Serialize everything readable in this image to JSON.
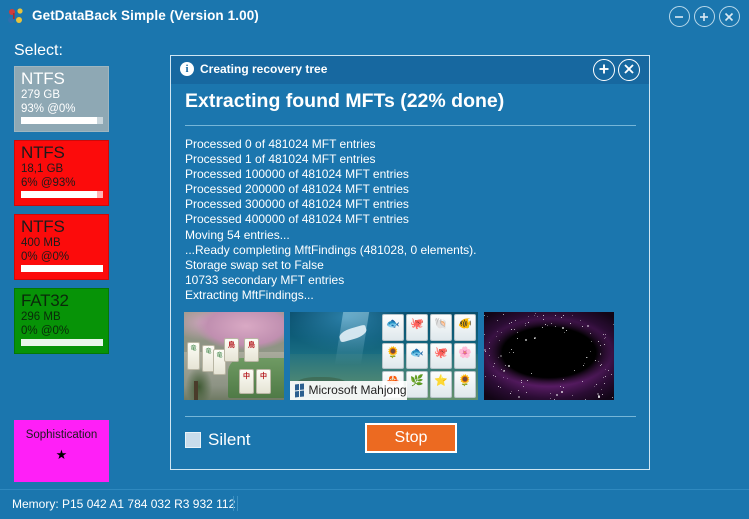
{
  "window": {
    "title": "GetDataBack Simple (Version 1.00)",
    "app_icon": "dots-icon",
    "controls": {
      "minimize": "minimize-icon",
      "maximize": "maximize-icon",
      "close": "close-icon"
    }
  },
  "sidebar": {
    "select_label": "Select:",
    "partitions": [
      {
        "filesystem": "NTFS",
        "size": "279 GB",
        "percent": "93% @0%"
      },
      {
        "filesystem": "NTFS",
        "size": "18,1 GB",
        "percent": "6% @93%"
      },
      {
        "filesystem": "NTFS",
        "size": "400 MB",
        "percent": "0% @0%"
      },
      {
        "filesystem": "FAT32",
        "size": "296 MB",
        "percent": "0% @0%"
      }
    ],
    "sophistication": {
      "label": "Sophistication",
      "star": "★"
    }
  },
  "dialog": {
    "title": "Creating recovery tree",
    "info_icon": "i",
    "heading": "Extracting found MFTs (22% done)",
    "buttons": {
      "add": "add-icon",
      "close": "close-icon"
    },
    "log_lines": [
      "Processed 0 of 481024 MFT entries",
      "Processed 1 of 481024 MFT entries",
      "Processed 100000 of 481024 MFT entries",
      "Processed 200000 of 481024 MFT entries",
      "Processed 300000 of 481024 MFT entries",
      "Processed 400000 of 481024 MFT entries",
      "Moving 54 entries...",
      "...Ready completing MftFindings (481028, 0 elements).",
      "Storage swap set to False",
      "10733 secondary MFT entries",
      "Extracting MftFindings..."
    ],
    "thumbnails": [
      {
        "name": "mahjong-garden-thumbnail",
        "caption": ""
      },
      {
        "name": "microsoft-mahjong-thumbnail",
        "caption": "Microsoft Mahjong"
      },
      {
        "name": "nebula-thumbnail",
        "caption": ""
      }
    ],
    "silent_label": "Silent",
    "silent_checked": false,
    "stop_label": "Stop"
  },
  "statusbar": {
    "memory": "Memory: P15 042 A1 784 032 R3 932 112"
  },
  "colors": {
    "window_background": "#1b76ae",
    "dialog_background": "#1b76ae",
    "dialog_border": "#cfe6f3",
    "accent_stop": "#ec6a21",
    "partition_selected": "#8ea8b4",
    "partition_ntfs": "#fc0b0b",
    "partition_fat32": "#079307",
    "sophistication": "#ff1ff7",
    "text": "#ffffff"
  }
}
